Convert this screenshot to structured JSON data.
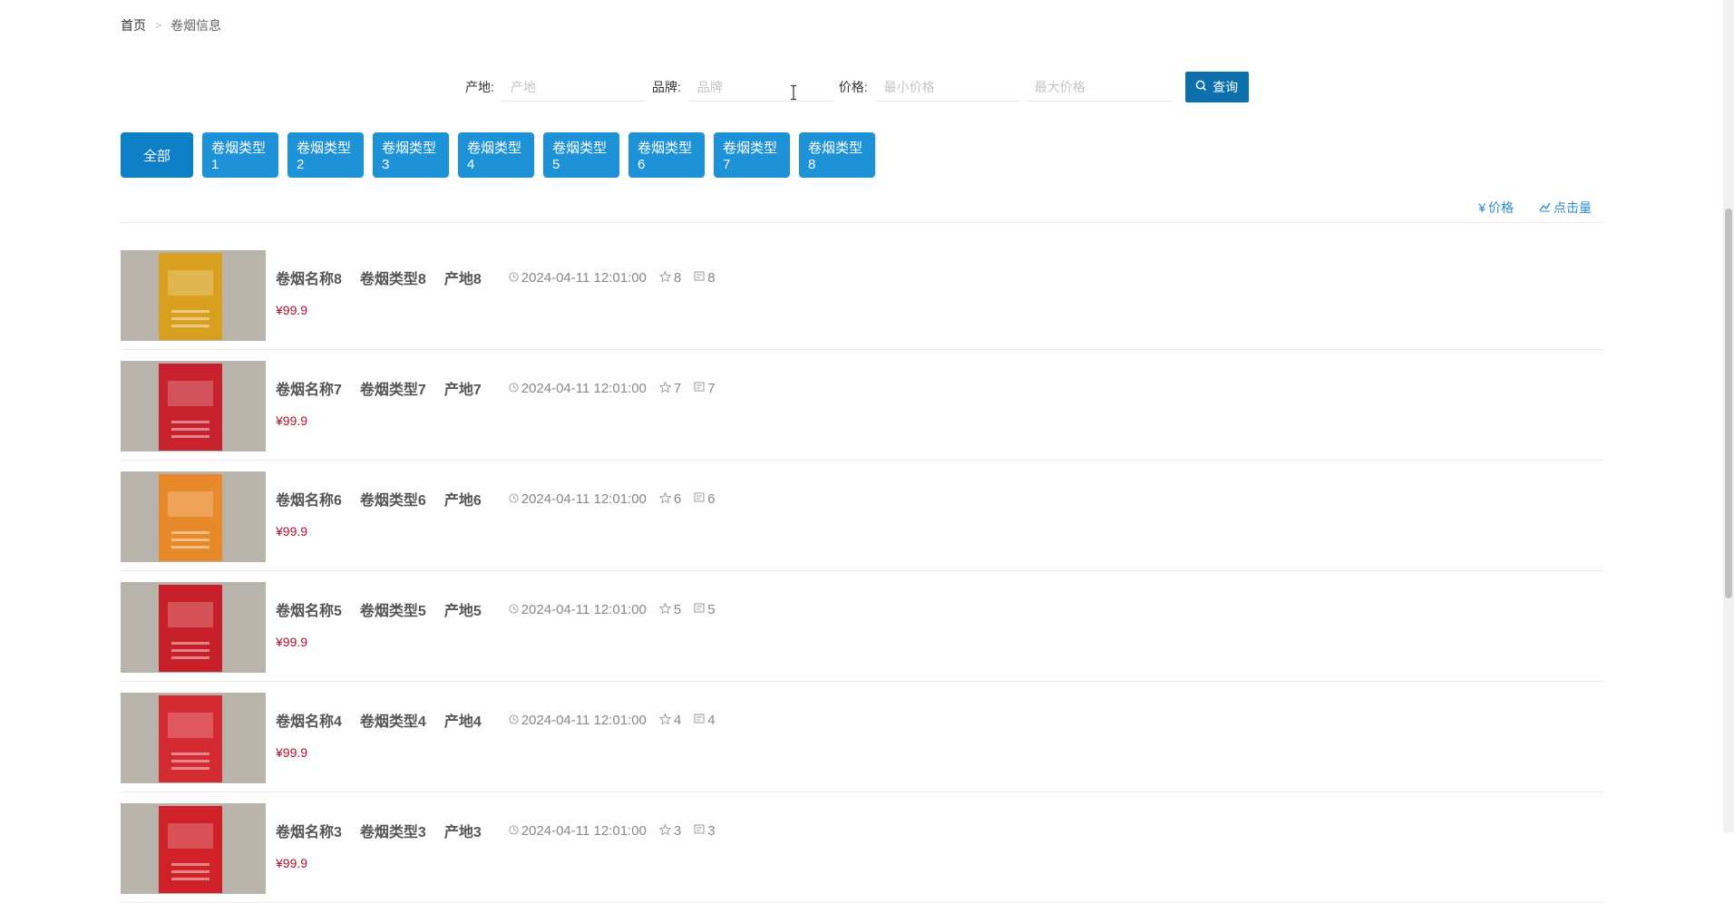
{
  "breadcrumb": {
    "home": "首页",
    "separator": ">",
    "current": "卷烟信息"
  },
  "search": {
    "origin_label": "产地:",
    "origin_placeholder": "产地",
    "brand_label": "品牌:",
    "brand_placeholder": "品牌",
    "price_label": "价格:",
    "min_price_placeholder": "最小价格",
    "max_price_placeholder": "最大价格",
    "query_button": "查询",
    "query_icon": "search-icon"
  },
  "categories": [
    "全部",
    "卷烟类型1",
    "卷烟类型2",
    "卷烟类型3",
    "卷烟类型4",
    "卷烟类型5",
    "卷烟类型6",
    "卷烟类型7",
    "卷烟类型8"
  ],
  "sort": {
    "price_label": "价格",
    "price_icon": "yen-icon",
    "clicks_label": "点击量",
    "clicks_icon": "trend-icon"
  },
  "items": [
    {
      "name": "卷烟名称8",
      "type": "卷烟类型8",
      "origin": "产地8",
      "date": "2024-04-11 12:01:00",
      "stars": "8",
      "comments": "8",
      "price": "¥99.9",
      "pack_color": "#d9a020"
    },
    {
      "name": "卷烟名称7",
      "type": "卷烟类型7",
      "origin": "产地7",
      "date": "2024-04-11 12:01:00",
      "stars": "7",
      "comments": "7",
      "price": "¥99.9",
      "pack_color": "#c8222e"
    },
    {
      "name": "卷烟名称6",
      "type": "卷烟类型6",
      "origin": "产地6",
      "date": "2024-04-11 12:01:00",
      "stars": "6",
      "comments": "6",
      "price": "¥99.9",
      "pack_color": "#e88a2a"
    },
    {
      "name": "卷烟名称5",
      "type": "卷烟类型5",
      "origin": "产地5",
      "date": "2024-04-11 12:01:00",
      "stars": "5",
      "comments": "5",
      "price": "¥99.9",
      "pack_color": "#c8202a"
    },
    {
      "name": "卷烟名称4",
      "type": "卷烟类型4",
      "origin": "产地4",
      "date": "2024-04-11 12:01:00",
      "stars": "4",
      "comments": "4",
      "price": "¥99.9",
      "pack_color": "#d42a32"
    },
    {
      "name": "卷烟名称3",
      "type": "卷烟类型3",
      "origin": "产地3",
      "date": "2024-04-11 12:01:00",
      "stars": "3",
      "comments": "3",
      "price": "¥99.9",
      "pack_color": "#d02028"
    }
  ],
  "colors": {
    "primary": "#1e92d6",
    "query_button": "#0d6fab",
    "price": "#b0102a",
    "link": "#2e8bcb"
  }
}
